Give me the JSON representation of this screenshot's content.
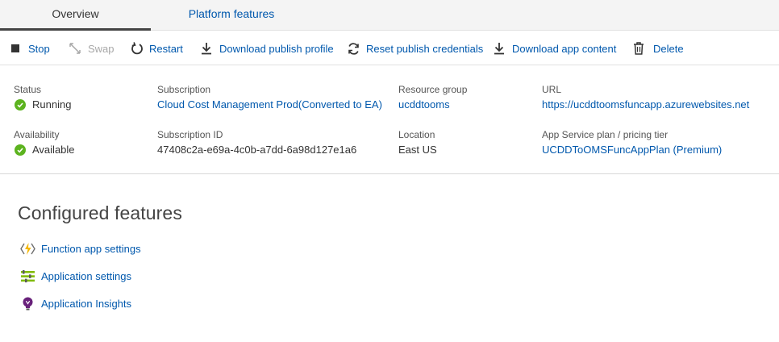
{
  "tabs": [
    {
      "label": "Overview",
      "active": true
    },
    {
      "label": "Platform features",
      "active": false
    }
  ],
  "toolbar": {
    "stop": "Stop",
    "swap": "Swap",
    "restart": "Restart",
    "download_publish_profile": "Download publish profile",
    "reset_publish_credentials": "Reset publish credentials",
    "download_app_content": "Download app content",
    "delete": "Delete"
  },
  "essentials": {
    "status": {
      "label": "Status",
      "value": "Running"
    },
    "availability": {
      "label": "Availability",
      "value": "Available"
    },
    "subscription": {
      "label": "Subscription",
      "value": "Cloud Cost Management Prod(Converted to EA)"
    },
    "subscription_id": {
      "label": "Subscription ID",
      "value": "47408c2a-e69a-4c0b-a7dd-6a98d127e1a6"
    },
    "resource_group": {
      "label": "Resource group",
      "value": "ucddtooms"
    },
    "location": {
      "label": "Location",
      "value": "East US"
    },
    "url": {
      "label": "URL",
      "value": "https://ucddtoomsfuncapp.azurewebsites.net"
    },
    "app_service_plan": {
      "label": "App Service plan / pricing tier",
      "value": "UCDDToOMSFuncAppPlan (Premium)"
    }
  },
  "configured": {
    "title": "Configured features",
    "items": [
      {
        "label": "Function app settings",
        "icon": "lightning-icon"
      },
      {
        "label": "Application settings",
        "icon": "settings-list-icon"
      },
      {
        "label": "Application Insights",
        "icon": "lightbulb-icon"
      }
    ]
  },
  "colors": {
    "link": "#0058ad",
    "running_green": "#5cb31f",
    "disabled": "#a8a8a8"
  }
}
